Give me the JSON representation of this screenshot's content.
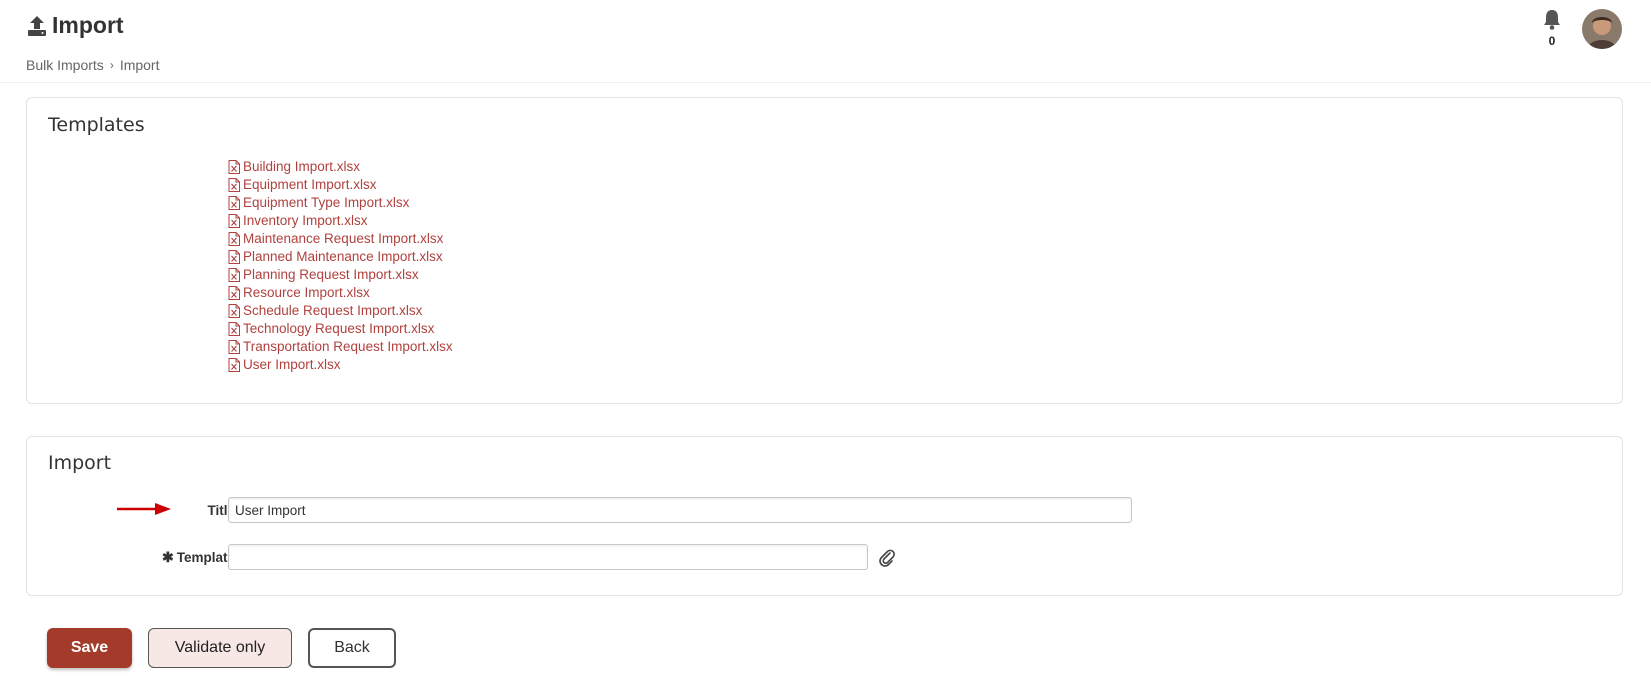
{
  "header": {
    "title": "Import",
    "title_icon": "upload-icon",
    "breadcrumb": [
      {
        "label": "Bulk Imports"
      },
      {
        "label": "Import"
      }
    ],
    "notifications": {
      "icon": "bell-icon",
      "count": "0"
    },
    "avatar": {
      "icon": "user-avatar"
    }
  },
  "templates": {
    "heading": "Templates",
    "file_icon": "excel-file-icon",
    "files": [
      {
        "label": "Building Import.xlsx"
      },
      {
        "label": "Equipment Import.xlsx"
      },
      {
        "label": "Equipment Type Import.xlsx"
      },
      {
        "label": "Inventory Import.xlsx"
      },
      {
        "label": "Maintenance Request Import.xlsx"
      },
      {
        "label": "Planned Maintenance Import.xlsx"
      },
      {
        "label": "Planning Request Import.xlsx"
      },
      {
        "label": "Resource Import.xlsx"
      },
      {
        "label": "Schedule Request Import.xlsx"
      },
      {
        "label": "Technology Request Import.xlsx"
      },
      {
        "label": "Transportation Request Import.xlsx"
      },
      {
        "label": "User Import.xlsx"
      }
    ]
  },
  "import": {
    "heading": "Import",
    "title_label": "Title",
    "title_value": "User Import",
    "template_label": "Template",
    "template_required_marker": "✱",
    "template_value": "",
    "attach_icon": "paperclip-icon",
    "annotation_icon": "red-arrow-icon"
  },
  "actions": {
    "save_label": "Save",
    "validate_label": "Validate only",
    "back_label": "Back"
  },
  "colors": {
    "link": "#b0413e",
    "primary_button": "#a33a2a",
    "secondary_button_bg": "#f7e8e6",
    "annotation_arrow": "#cc0000"
  }
}
